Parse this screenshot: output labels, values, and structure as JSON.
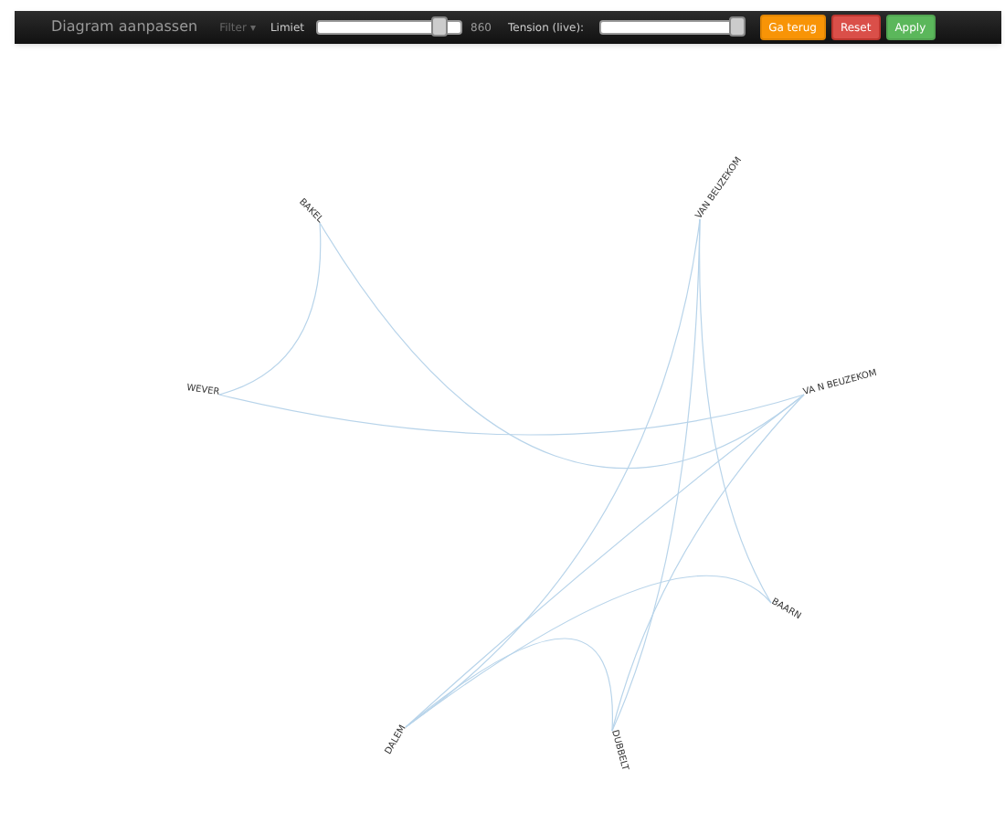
{
  "toolbar": {
    "title": "Diagram aanpassen",
    "filter": {
      "label": "Filter",
      "caret": "▾",
      "disabled": true
    },
    "limit": {
      "label": "Limiet",
      "level": 0.86,
      "reading": "860"
    },
    "tension": {
      "label": "Tension (live):",
      "level": 0.97
    },
    "buttons": [
      {
        "label": "Ga terug",
        "kind": "warning"
      },
      {
        "label": "Reset",
        "kind": "danger"
      },
      {
        "label": "Apply",
        "kind": "success"
      }
    ]
  },
  "diagram": {
    "nodes": [
      {
        "label": "BAKEL"
      },
      {
        "label": "WEVER"
      },
      {
        "label": "VAN BEUZEKOM"
      },
      {
        "label": "VA N BEUZEKOM"
      },
      {
        "label": "BAARN"
      },
      {
        "label": "DALEM"
      },
      {
        "label": "DUBBELT"
      }
    ]
  }
}
